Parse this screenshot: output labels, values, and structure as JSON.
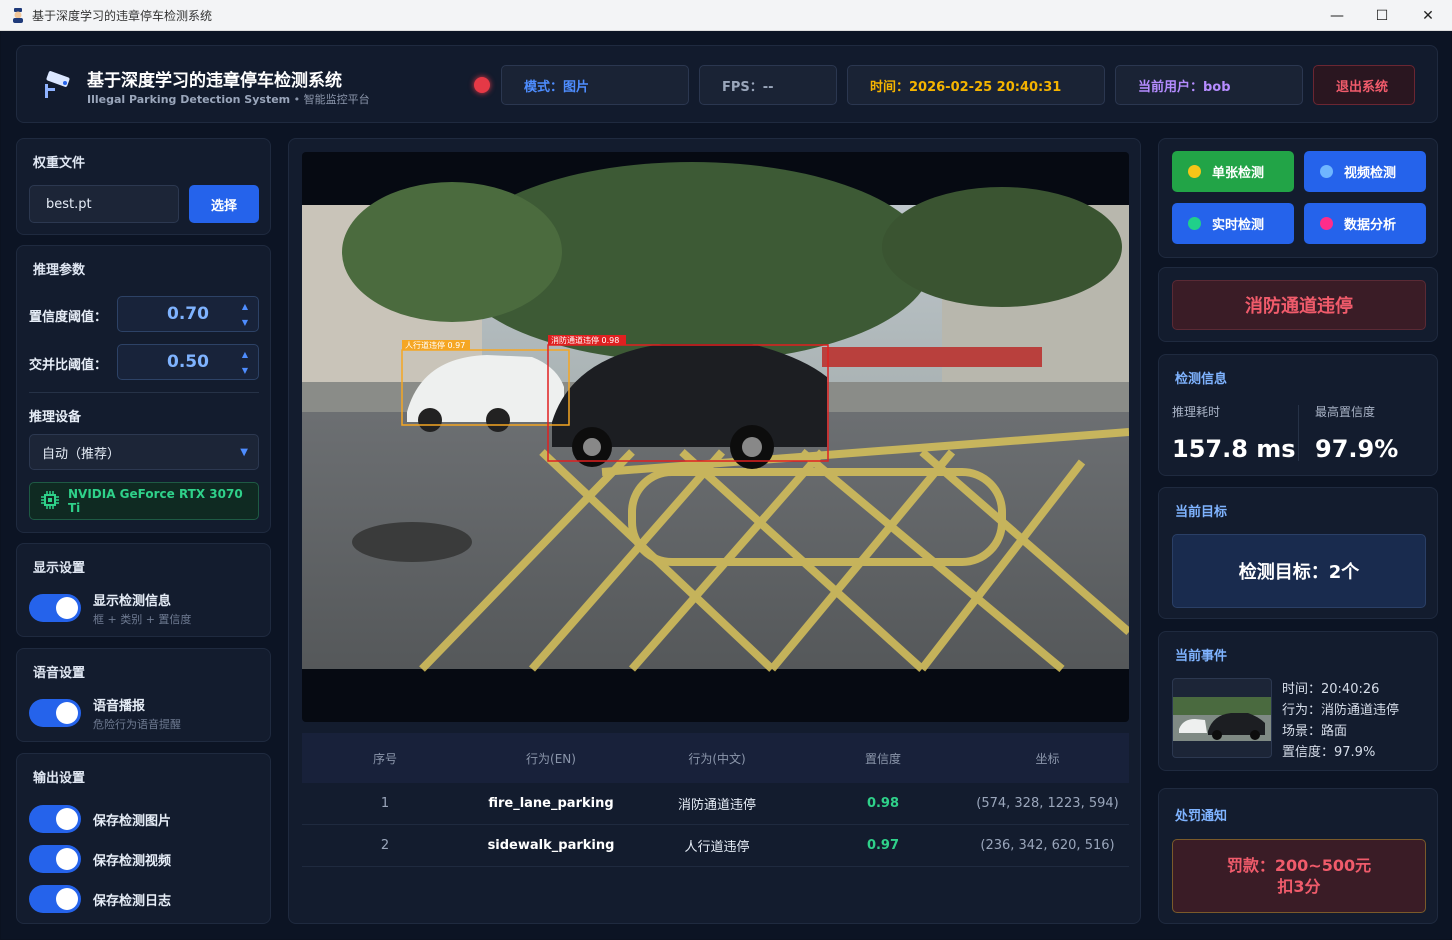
{
  "window": {
    "title": "基于深度学习的违章停车检测系统",
    "minimize": "—",
    "maximize": "☐",
    "close": "✕"
  },
  "header": {
    "title": "基于深度学习的违章停车检测系统",
    "subtitle_en": "Illegal Parking Detection System",
    "subtitle_cn": " • 智能监控平台",
    "mode": "模式：图片",
    "fps": "FPS：--",
    "time": "时间：2026-02-25 20:40:31",
    "user": "当前用户：bob",
    "logout": "退出系统",
    "colors": {
      "mode": "#4e8dff",
      "time": "#f5b400",
      "user": "#b58cff",
      "logout": "#f05b6b"
    }
  },
  "weights": {
    "title": "权重文件",
    "file": "best.pt",
    "select": "选择"
  },
  "inference": {
    "title": "推理参数",
    "conf_label": "置信度阈值：",
    "conf_value": "0.70",
    "iou_label": "交并比阈值：",
    "iou_value": "0.50",
    "device_title": "推理设备",
    "device_value": "自动（推荐）",
    "gpu": "NVIDIA GeForce RTX 3070 Ti"
  },
  "display": {
    "title": "显示设置",
    "toggle_label": "显示检测信息",
    "toggle_sub": "框 + 类别 + 置信度",
    "enabled": true
  },
  "voice": {
    "title": "语音设置",
    "toggle_label": "语音播报",
    "toggle_sub": "危险行为语音提醒",
    "enabled": true
  },
  "output": {
    "title": "输出设置",
    "items": [
      {
        "label": "保存检测图片",
        "enabled": true
      },
      {
        "label": "保存检测视频",
        "enabled": true
      },
      {
        "label": "保存检测日志",
        "enabled": true
      }
    ]
  },
  "detections_overlay": [
    {
      "label": "人行道违停 0.97",
      "color": "#f5a623"
    },
    {
      "label": "消防通道违停 0.98",
      "color": "#e02020"
    }
  ],
  "table": {
    "headers": [
      "序号",
      "行为(EN)",
      "行为(中文)",
      "置信度",
      "坐标"
    ],
    "rows": [
      {
        "idx": "1",
        "en": "fire_lane_parking",
        "cn": "消防通道违停",
        "conf": "0.98",
        "coords": "(574, 328, 1223, 594)"
      },
      {
        "idx": "2",
        "en": "sidewalk_parking",
        "cn": "人行道违停",
        "conf": "0.97",
        "coords": "(236, 342, 620, 516)"
      }
    ]
  },
  "modes": [
    {
      "label": "单张检测",
      "bg": "#22a447",
      "dot": "#f5c518"
    },
    {
      "label": "视频检测",
      "bg": "#2563eb",
      "dot": "#6fb6ff"
    },
    {
      "label": "实时检测",
      "bg": "#2563eb",
      "dot": "#20d08a"
    },
    {
      "label": "数据分析",
      "bg": "#2563eb",
      "dot": "#ff2d8a"
    }
  ],
  "alert": "消防通道违停",
  "detect_info": {
    "title": "检测信息",
    "time_label": "推理耗时",
    "time_value": "157.8 ms",
    "conf_label": "最高置信度",
    "conf_value": "97.9%"
  },
  "current_target": {
    "title": "当前目标",
    "value": "检测目标：2个"
  },
  "current_event": {
    "title": "当前事件",
    "time": "时间：20:40:26",
    "behavior": "行为：消防通道违停",
    "scene": "场景：路面",
    "conf": "置信度：97.9%"
  },
  "penalty": {
    "title": "处罚通知",
    "line1": "罚款：200~500元",
    "line2": "扣3分"
  }
}
